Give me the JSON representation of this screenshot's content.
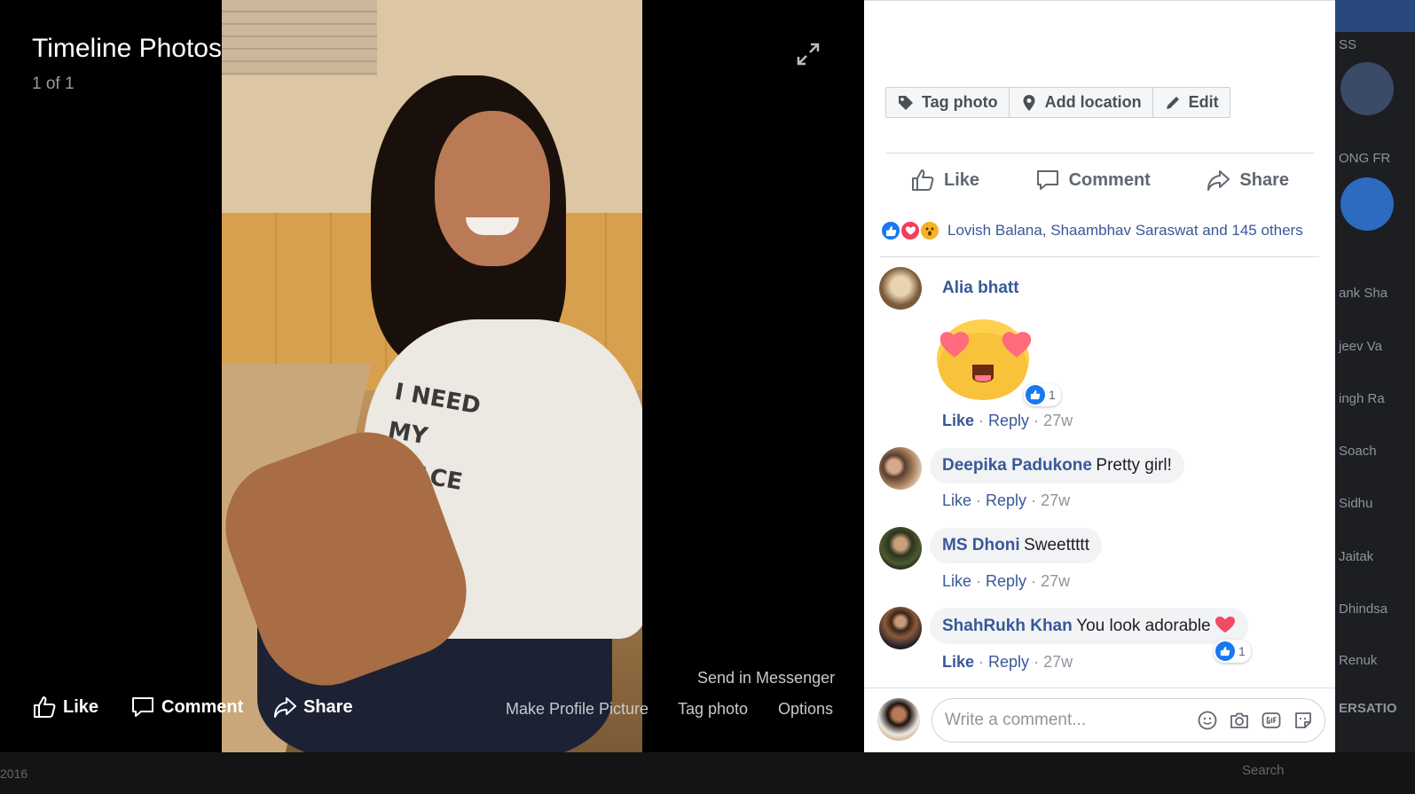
{
  "viewer": {
    "title": "Timeline Photos",
    "count": "1 of 1",
    "photo_print_line1": "I NEED MY",
    "photo_print_line2": "SPACE",
    "actions": {
      "like": "Like",
      "comment": "Comment",
      "share": "Share"
    },
    "links": {
      "send_messenger": "Send in Messenger",
      "make_profile": "Make Profile Picture",
      "tag_photo": "Tag photo",
      "options": "Options"
    }
  },
  "toolbar": {
    "tag_photo": "Tag photo",
    "add_location": "Add location",
    "edit": "Edit"
  },
  "actions": {
    "like": "Like",
    "comment": "Comment",
    "share": "Share"
  },
  "reactions": {
    "types": [
      "like",
      "love",
      "wow"
    ],
    "text": "Lovish Balana, Shaambhav Saraswat and 145 others"
  },
  "comments": [
    {
      "name": "Alia bhatt",
      "text": "",
      "sticker": "heart-eyes",
      "like": "Like",
      "reply": "Reply",
      "time": "27w",
      "reaction_count": "1"
    },
    {
      "name": "Deepika Padukone",
      "text": "Pretty girl!",
      "like": "Like",
      "reply": "Reply",
      "time": "27w"
    },
    {
      "name": "MS Dhoni",
      "text": "Sweettttt",
      "like": "Like",
      "reply": "Reply",
      "time": "27w"
    },
    {
      "name": "ShahRukh Khan",
      "text": "You look adorable",
      "like": "Like",
      "reply": "Reply",
      "time": "27w",
      "reaction_count": "1"
    }
  ],
  "composer": {
    "placeholder": "Write a comment..."
  },
  "background": {
    "peek_labels": [
      "SS",
      "ONG FR",
      "ank Sha",
      "jeev Va",
      "ingh Ra",
      "Soach",
      "Sidhu",
      "Jaitak",
      "Dhindsa",
      "Renuk",
      "ERSATIO"
    ],
    "bottom_year": "2016",
    "bottom_search": "Search"
  },
  "colors": {
    "brand": "#385898",
    "like_blue": "#1877f2",
    "love_red": "#f33e58",
    "wow_yellow": "#f7b125"
  }
}
